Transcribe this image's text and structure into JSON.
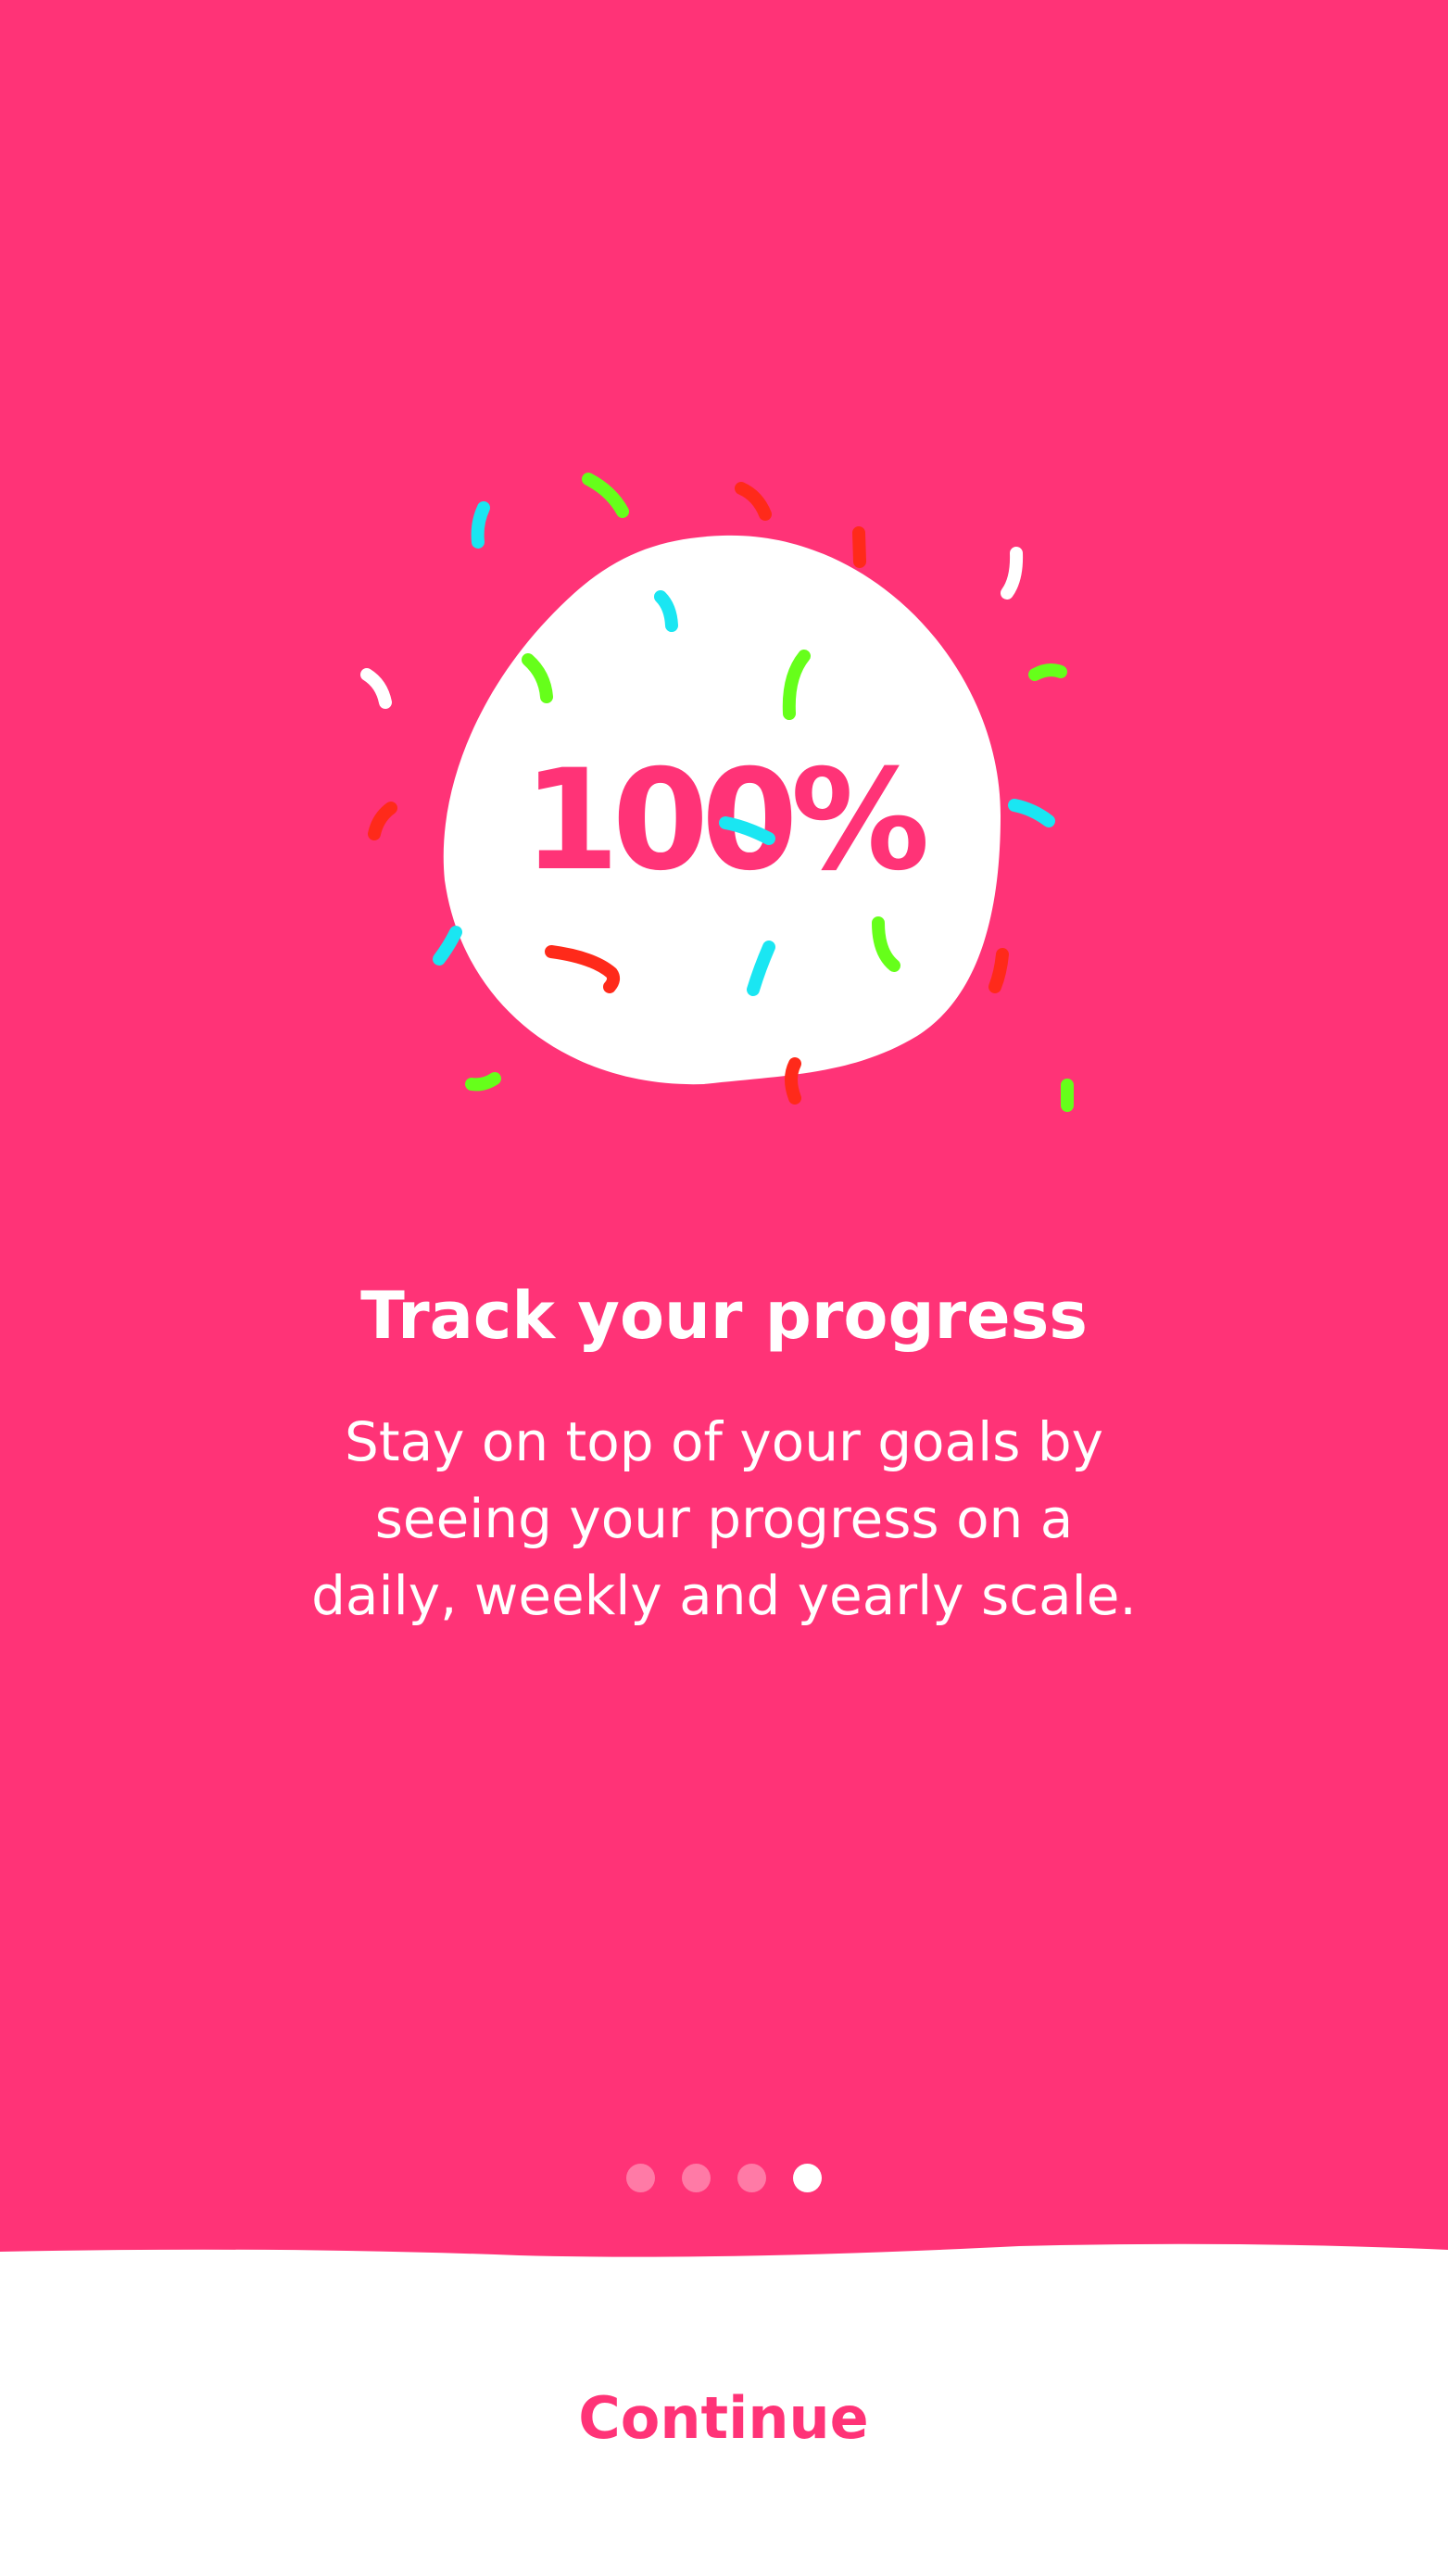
{
  "colors": {
    "background": "#ff3377",
    "surface": "#ffffff",
    "accent": "#ff3377",
    "confetti": [
      "#ff2a1a",
      "#66ff1a",
      "#1ae6f2",
      "#ffffff"
    ]
  },
  "onboarding": {
    "illustration": {
      "badge_text": "100%",
      "icon": "confetti-blob-icon"
    },
    "title": "Track your progress",
    "description_lines": [
      "Stay on top of your goals by",
      "seeing your progress on a",
      "daily, weekly and yearly scale."
    ],
    "pager": {
      "total": 4,
      "current": 4
    },
    "continue_label": "Continue"
  }
}
